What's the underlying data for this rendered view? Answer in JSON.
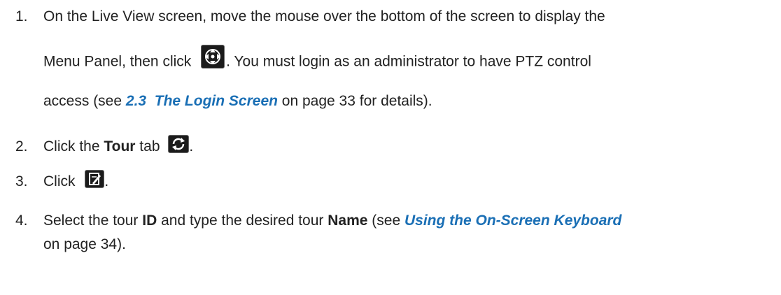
{
  "steps": [
    {
      "number": "1.",
      "line1": "On the Live View screen, move the mouse over the bottom of the screen to display the",
      "line2_pre": "Menu Panel, then click",
      "icon": "ptz-move-icon",
      "line2_post": ". You must login as an administrator to have PTZ control",
      "line3_pre": "access (see ",
      "link_section": "2.3",
      "link_title": "The Login Screen",
      "line3_post": " on page 33 for details)."
    },
    {
      "number": "2.",
      "pre": "Click the ",
      "bold": "Tour",
      "mid": " tab",
      "icon": "refresh-tour-icon",
      "post": "."
    },
    {
      "number": "3.",
      "pre": "Click",
      "icon": "edit-note-icon",
      "post": "."
    },
    {
      "number": "4.",
      "pre": "Select the tour ",
      "bold1": "ID",
      "mid": " and type the desired tour ",
      "bold2": "Name",
      "mid2": " (see ",
      "link": "Using the On-Screen Keyboard",
      "line2": "on page 34)."
    }
  ],
  "colors": {
    "text": "#222222",
    "link": "#1a6fb5",
    "icon_bg": "#1b1b1b"
  }
}
